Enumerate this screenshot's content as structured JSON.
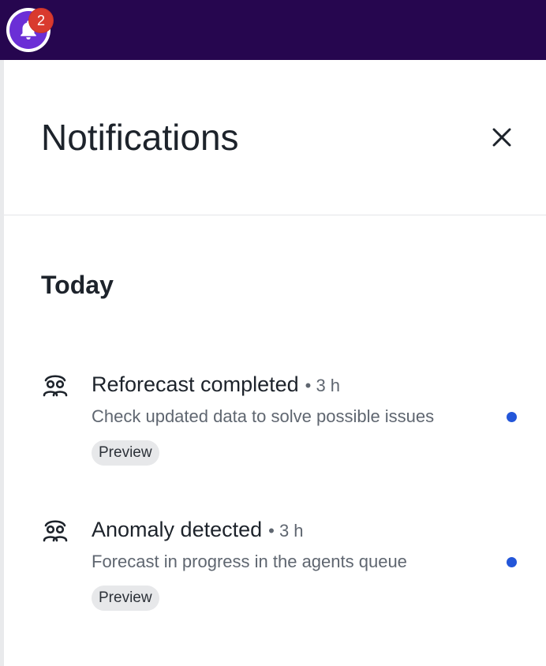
{
  "header": {
    "notification_count": "2",
    "bell_icon": "bell-icon"
  },
  "panel": {
    "title": "Notifications",
    "close_icon": "close-icon"
  },
  "sections": [
    {
      "title": "Today",
      "items": [
        {
          "icon": "team-icon",
          "title": "Reforecast completed",
          "time": "• 3 h",
          "description": "Check updated data to solve possible issues",
          "tag": "Preview",
          "unread": true,
          "unread_color": "#2356d9"
        },
        {
          "icon": "team-icon",
          "title": "Anomaly detected",
          "time": "• 3 h",
          "description": "Forecast in progress in the agents queue",
          "tag": "Preview",
          "unread": true,
          "unread_color": "#2356d9"
        }
      ]
    }
  ],
  "colors": {
    "topbar": "#26064f",
    "bell_accent": "#6b2fd6",
    "badge": "#d93a2e"
  }
}
